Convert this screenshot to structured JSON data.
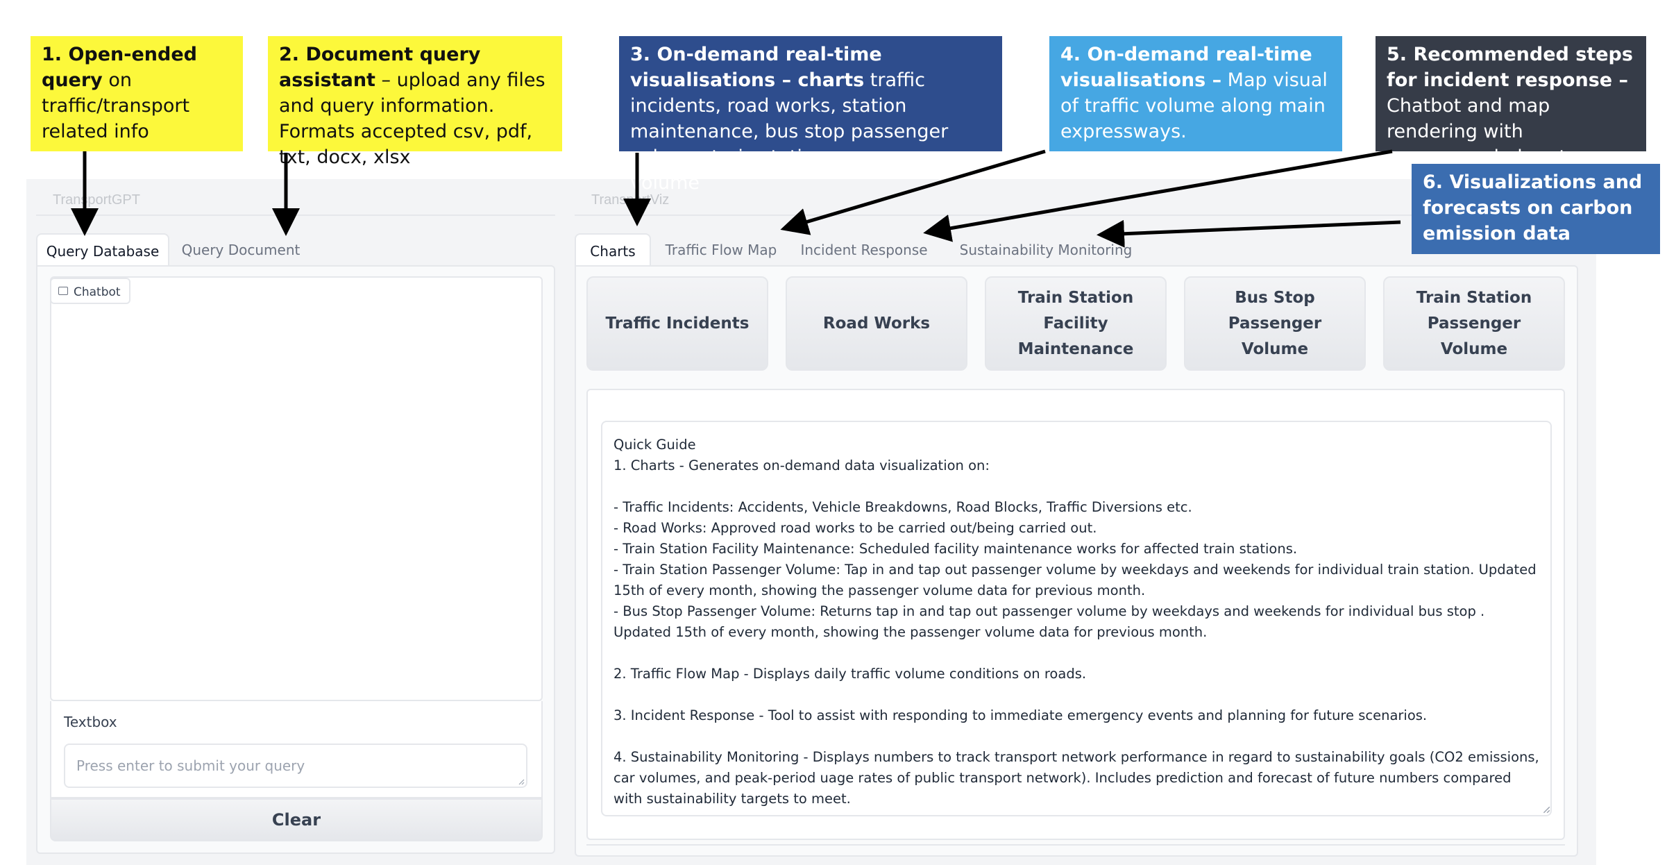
{
  "callouts": [
    {
      "bold": "1. Open-ended query",
      "rest": " on traffic/transport related info"
    },
    {
      "bold": "2. Document query assistant",
      "rest": " – upload any files and query information. Formats accepted csv, pdf, txt, docx, xlsx"
    },
    {
      "bold": "3. On-demand real-time visualisations – charts",
      "rest": " traffic incidents, road works, station maintenance, bus stop passenger volume, train station passenger volume"
    },
    {
      "bold": "4. On-demand real-time visualisations –",
      "rest": " Map visual of traffic volume along main expressways."
    },
    {
      "bold": "5. Recommended steps for incident response –",
      "rest": " Chatbot and map rendering with recommended routes"
    },
    {
      "bold": "6. Visualizations and forecasts on carbon emission data",
      "rest": ""
    }
  ],
  "left_panel": {
    "title": "TransportGPT",
    "tabs": [
      "Query Database",
      "Query Document"
    ],
    "chatbot_label": "Chatbot",
    "textbox_label": "Textbox",
    "textbox_placeholder": "Press enter to submit your query",
    "clear_label": "Clear"
  },
  "right_panel": {
    "title": "TransportViz",
    "tabs": [
      "Charts",
      "Traffic Flow Map",
      "Incident Response",
      "Sustainability Monitoring"
    ],
    "buttons": [
      "Traffic Incidents",
      "Road Works",
      "Train Station Facility Maintenance",
      "Bus Stop Passenger Volume",
      "Train Station Passenger Volume"
    ],
    "quick_guide": "Quick Guide\n1. Charts - Generates on-demand data visualization on:\n\n- Traffic Incidents: Accidents, Vehicle Breakdowns, Road Blocks, Traffic Diversions etc.\n- Road Works: Approved road works to be carried out/being carried out.\n- Train Station Facility Maintenance: Scheduled facility maintenance works for affected train stations.\n- Train Station Passenger Volume: Tap in and tap out passenger volume by weekdays and weekends for individual train station. Updated 15th of every month, showing the passenger volume data for previous month.\n- Bus Stop Passenger Volume: Returns tap in and tap out passenger volume by weekdays and weekends for individual bus stop . Updated 15th of every month, showing the passenger volume data for previous month.\n\n2. Traffic Flow Map - Displays daily traffic volume conditions on roads.\n\n3. Incident Response - Tool to assist with responding to immediate emergency events and planning for future scenarios.\n\n4. Sustainability Monitoring - Displays numbers to track transport network performance in regard to sustainability goals (CO2 emissions, car volumes, and peak-period uage rates of public transport network). Includes prediction and forecast of future numbers compared with sustainability targets to meet."
  },
  "colors": {
    "callout_yellow": "#fcf83b",
    "callout_navy": "#2e4d8d",
    "callout_sky": "#46a7e3",
    "callout_slate": "#363c48",
    "callout_steel": "#3b6db0"
  }
}
